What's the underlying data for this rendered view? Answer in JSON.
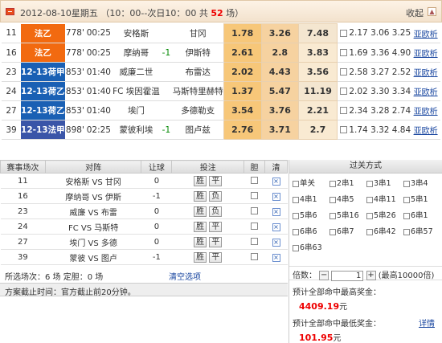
{
  "header": {
    "date_prefix": "2012-08-10星期五 （10：00--次日10：00 共",
    "count": "52",
    "date_suffix": "场）",
    "collapse": "收起",
    "arrow": "▲"
  },
  "colors": {
    "league_1": "#f26a10",
    "league_2": "#1a60b4",
    "league_3": "#3a55a8"
  },
  "top_rows": [
    {
      "no": "11",
      "league": "法乙",
      "league_color": "#f26a10",
      "code": "778'",
      "time": "00:25",
      "home": "安格斯",
      "handicap": "",
      "away": "甘冈",
      "o1": "1.78",
      "o2": "3.26",
      "o3": "7.48",
      "odds": "2.17 3.06 3.25",
      "link": "亚欧析"
    },
    {
      "no": "16",
      "league": "法乙",
      "league_color": "#f26a10",
      "code": "778'",
      "time": "00:25",
      "home": "摩纳哥",
      "handicap": "-1",
      "away": "伊斯特",
      "o1": "2.61",
      "o2": "2.8",
      "o3": "3.83",
      "odds": "1.69 3.36 4.90",
      "link": "亚欧析"
    },
    {
      "no": "23",
      "league": "12-13荷甲",
      "league_color": "#1a60b4",
      "code": "853'",
      "time": "01:40",
      "home": "威廉二世",
      "handicap": "",
      "away": "布雷达",
      "o1": "2.02",
      "o2": "4.43",
      "o3": "3.56",
      "odds": "2.58 3.27 2.52",
      "link": "亚欧析"
    },
    {
      "no": "24",
      "league": "12-13荷乙",
      "league_color": "#1a60b4",
      "code": "853'",
      "time": "01:40",
      "home": "FC 埃因霍温",
      "handicap": "",
      "away": "马斯特里赫特",
      "o1": "1.37",
      "o2": "5.47",
      "o3": "11.19",
      "odds": "2.02 3.30 3.34",
      "link": "亚欧析"
    },
    {
      "no": "27",
      "league": "12-13荷乙",
      "league_color": "#1a60b4",
      "code": "853'",
      "time": "01:40",
      "home": "埃门",
      "handicap": "",
      "away": "多德勒支",
      "o1": "3.54",
      "o2": "3.76",
      "o3": "2.21",
      "odds": "2.34 3.28 2.74",
      "link": "亚欧析"
    },
    {
      "no": "39",
      "league": "12-13法甲",
      "league_color": "#3a55a8",
      "code": "898'",
      "time": "02:25",
      "home": "蒙彼利埃",
      "handicap": "-1",
      "away": "图卢兹",
      "o1": "2.76",
      "o2": "3.71",
      "o3": "2.7",
      "odds": "1.74 3.32 4.84",
      "link": "亚欧析"
    }
  ],
  "table_headers": {
    "no": "赛事场次",
    "match": "对阵",
    "handicap": "让球",
    "bet": "投注",
    "dan": "胆",
    "clear": "清",
    "pass": "过关方式"
  },
  "bottom_rows": [
    {
      "no": "11",
      "match": "安格斯 VS 甘冈",
      "hc": "0",
      "b1": "胜",
      "b2": "平"
    },
    {
      "no": "16",
      "match": "摩纳哥 VS 伊斯",
      "hc": "-1",
      "b1": "胜",
      "b2": "负"
    },
    {
      "no": "23",
      "match": "威廉 VS 布雷",
      "hc": "0",
      "b1": "胜",
      "b2": "负"
    },
    {
      "no": "24",
      "match": "FC VS 马斯特",
      "hc": "0",
      "b1": "胜",
      "b2": "平"
    },
    {
      "no": "27",
      "match": "埃门 VS 多德",
      "hc": "0",
      "b1": "胜",
      "b2": "平"
    },
    {
      "no": "39",
      "match": "蒙彼 VS 图卢",
      "hc": "-1",
      "b1": "胜",
      "b2": "平"
    }
  ],
  "selected": {
    "text": "所选场次：6 场 定胆：0 场",
    "clear": "清空选项"
  },
  "deadline": "方案截止时间：官方截止前20分钟。",
  "pass_options": [
    "单关",
    "2串1",
    "3串1",
    "3串4",
    "4串1",
    "4串5",
    "4串11",
    "5串1",
    "5串6",
    "5串16",
    "5串26",
    "6串1",
    "6串6",
    "6串7",
    "6串42",
    "6串57",
    "6串63"
  ],
  "multiplier": {
    "label": "倍数：",
    "value": "1",
    "max": "(最高10000倍)",
    "minus": "−",
    "plus": "+"
  },
  "estimate": {
    "max_label": "预计全部命中最高奖金：",
    "max_value": "4409.19",
    "unit": "元",
    "min_label": "预计全部命中最低奖金：",
    "min_value": "101.95",
    "detail": "详情"
  }
}
